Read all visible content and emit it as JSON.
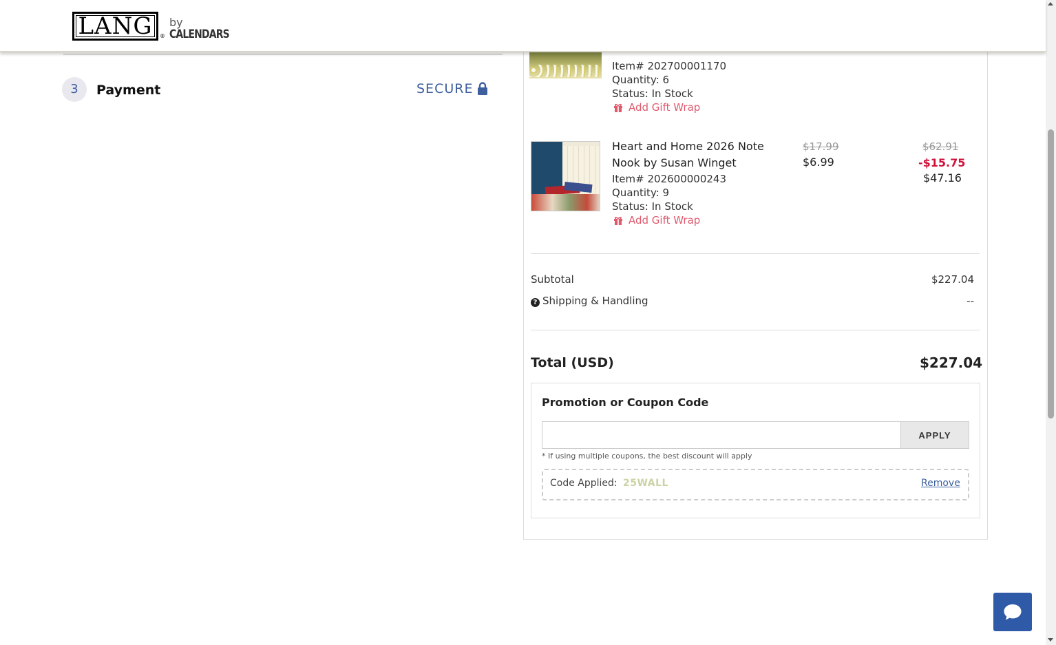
{
  "header": {
    "logo_main": "LANG",
    "logo_reg": "®",
    "logo_by": "by",
    "logo_brand": "CALENDARS"
  },
  "checkout": {
    "step_number": "3",
    "step_title": "Payment",
    "secure_label": "SECURE"
  },
  "items": [
    {
      "item_no": "Item# 202700001170",
      "quantity": "Quantity: 6",
      "status": "Status: In Stock",
      "gift_wrap": "Add Gift Wrap"
    },
    {
      "name_line1": "Heart and Home 2026 Note",
      "name_line2": "Nook by Susan Winget",
      "item_no": "Item# 202600000243",
      "quantity": "Quantity: 9",
      "status": "Status: In Stock",
      "gift_wrap": "Add Gift Wrap",
      "unit_price_original": "$17.99",
      "unit_price": "$6.99",
      "line_original": "$62.91",
      "line_discount": "-$15.75",
      "line_total": "$47.16"
    }
  ],
  "totals": {
    "subtotal_label": "Subtotal",
    "subtotal_value": "$227.04",
    "shipping_label": "Shipping & Handling",
    "shipping_value": "--",
    "total_label": "Total (USD)",
    "total_value": "$227.04"
  },
  "promo": {
    "title": "Promotion or Coupon Code",
    "input_value": "",
    "apply_label": "APPLY",
    "note": "* If using multiple coupons, the best discount will apply",
    "applied_label": "Code Applied:",
    "applied_code": "25WALL",
    "remove_label": "Remove"
  },
  "colors": {
    "accent_blue": "#3d5f9e",
    "discount_red": "#d0103a",
    "gift_pink": "#e05a6e",
    "chat_blue": "#2f5aa8"
  }
}
